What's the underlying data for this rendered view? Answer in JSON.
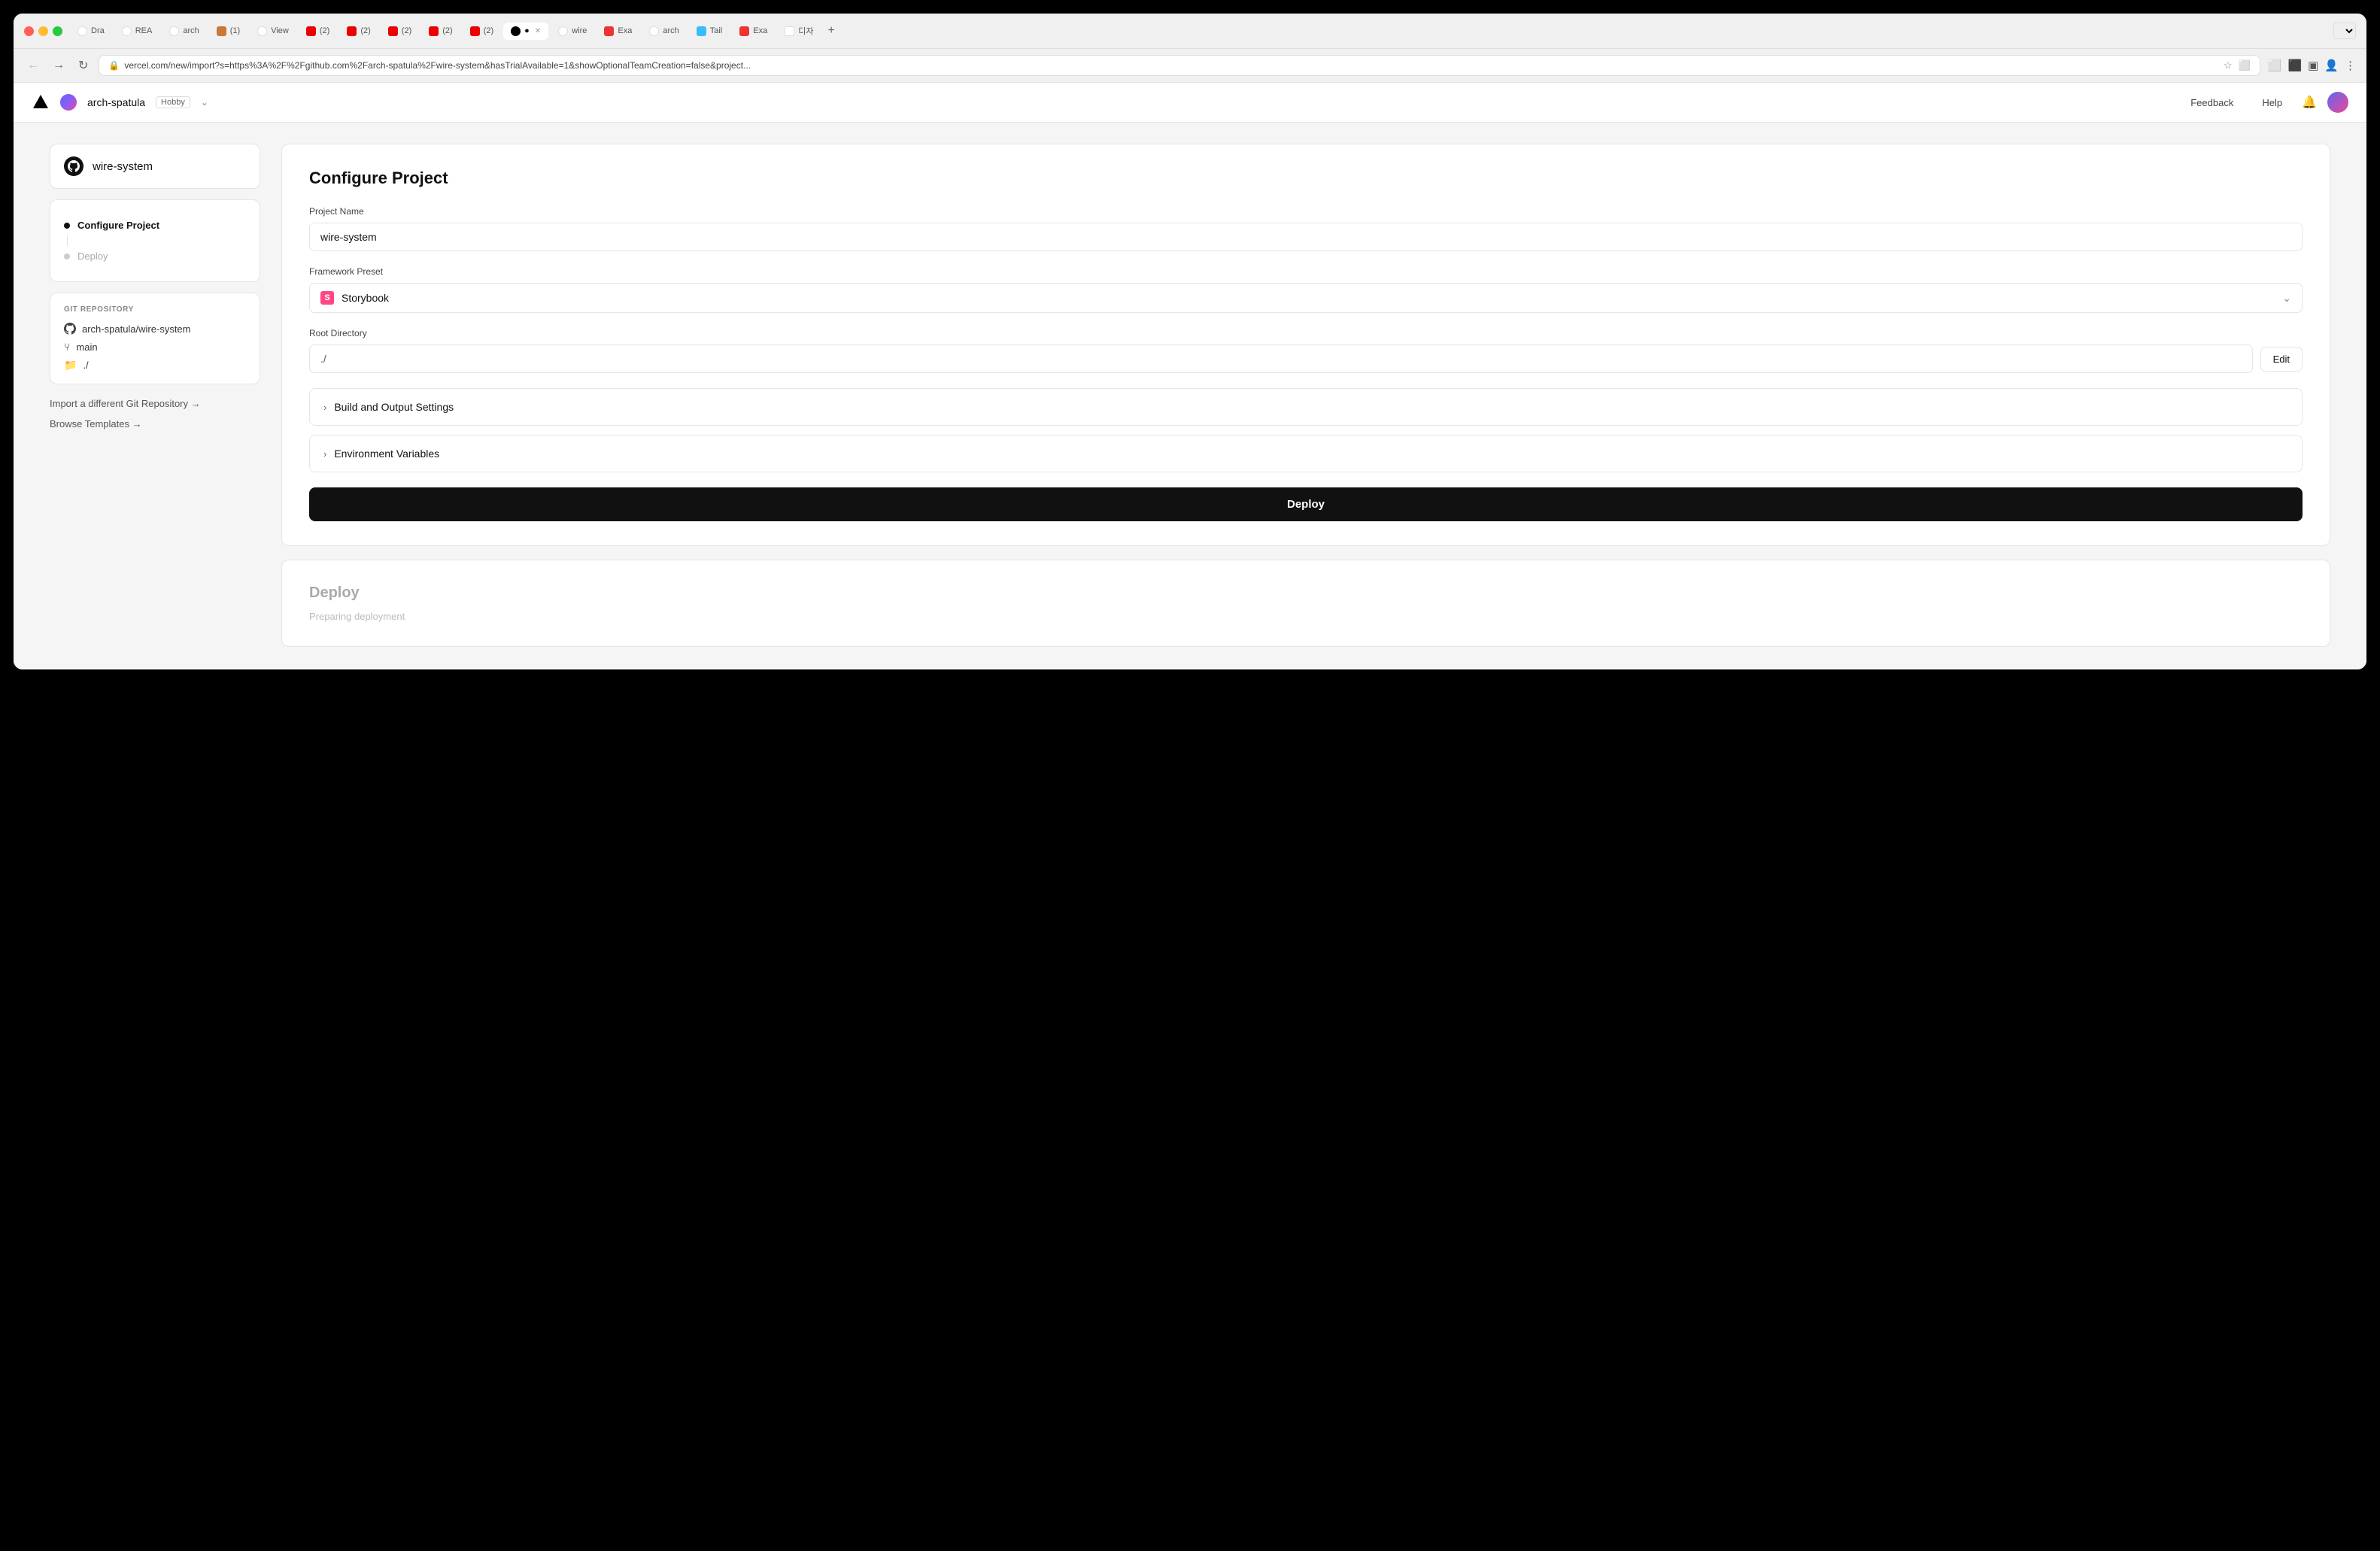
{
  "browser": {
    "tabs": [
      {
        "label": "[Dra",
        "favicon_color": "#fff",
        "active": false
      },
      {
        "label": "REA",
        "favicon_color": "#fff",
        "active": false
      },
      {
        "label": "arc",
        "favicon_color": "#fff",
        "active": false
      },
      {
        "label": "(1)",
        "favicon_color": "#c73",
        "active": false
      },
      {
        "label": "Vie",
        "favicon_color": "#fff",
        "active": false
      },
      {
        "label": "(2)",
        "favicon_color": "#e00",
        "active": false
      },
      {
        "label": "(2)",
        "favicon_color": "#e00",
        "active": false
      },
      {
        "label": "(2)",
        "favicon_color": "#e00",
        "active": false
      },
      {
        "label": "(2)",
        "favicon_color": "#e00",
        "active": false
      },
      {
        "label": "(2)",
        "favicon_color": "#e00",
        "active": false
      },
      {
        "label": "●",
        "active": true,
        "is_active": true
      },
      {
        "label": "wire",
        "favicon_color": "#fff",
        "active": false
      },
      {
        "label": "Exa",
        "favicon_color": "#e33",
        "active": false
      },
      {
        "label": "arc",
        "favicon_color": "#fff",
        "active": false
      },
      {
        "label": "Tail",
        "favicon_color": "#38bdf8",
        "active": false
      },
      {
        "label": "Exa",
        "favicon_color": "#e33",
        "active": false
      },
      {
        "label": "디자",
        "favicon_color": "#fff",
        "active": false
      }
    ],
    "url": "vercel.com/new/import?s=https%3A%2F%2Fgithub.com%2Farch-spatula%2Fwire-system&hasTrialAvailable=1&showOptionalTeamCreation=false&project...",
    "back_disabled": false,
    "forward_disabled": true
  },
  "header": {
    "team_name": "arch-spatula",
    "team_plan": "Hobby",
    "feedback_label": "Feedback",
    "help_label": "Help"
  },
  "sidebar": {
    "repo_name": "wire-system",
    "steps": [
      {
        "label": "Configure Project",
        "active": true
      },
      {
        "label": "Deploy",
        "active": false
      }
    ],
    "git_section_label": "GIT REPOSITORY",
    "git_repo": "arch-spatula/wire-system",
    "git_branch": "main",
    "git_dir": "./",
    "import_link": "Import a different Git Repository →",
    "browse_link": "Browse Templates →"
  },
  "configure_project": {
    "title": "Configure Project",
    "project_name_label": "Project Name",
    "project_name_value": "wire-system",
    "framework_label": "Framework Preset",
    "framework_value": "Storybook",
    "root_dir_label": "Root Directory",
    "root_dir_value": "./",
    "edit_btn": "Edit",
    "build_settings_label": "Build and Output Settings",
    "env_vars_label": "Environment Variables",
    "deploy_btn": "Deploy"
  },
  "deploy_section": {
    "title": "Deploy",
    "preparing_text": "Preparing deployment"
  }
}
